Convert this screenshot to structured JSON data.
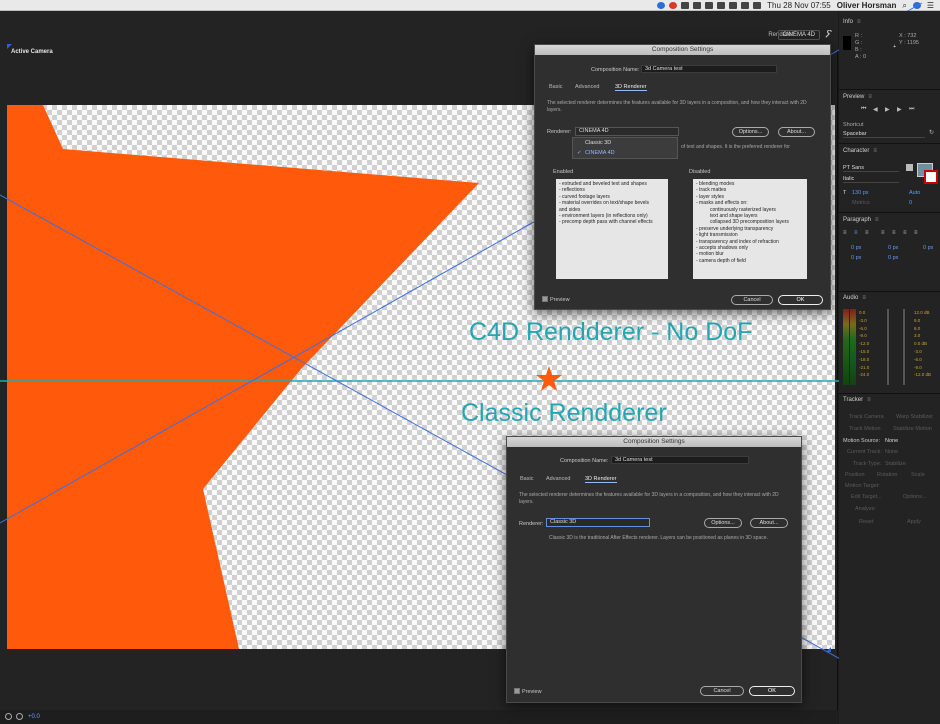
{
  "menubar": {
    "date_time": "Thu 28 Nov  07:55",
    "user": "Oliver Horsman"
  },
  "viewer": {
    "camera_label": "Active Camera",
    "renderer_label": "Renderer:",
    "renderer_value": "CINEMA 4D",
    "zoom": "+0.0"
  },
  "annotations": {
    "c4d": "C4D Rendderer - No DoF",
    "classic": "Classic Rendderer"
  },
  "dialog_c4d": {
    "title": "Composition Settings",
    "name_label": "Composition Name:",
    "name_value": "3d Camera test",
    "tabs": [
      "Basic",
      "Advanced",
      "3D Renderer"
    ],
    "description": "The selected renderer determines the features available for 3D layers in a composition, and how they interact with 2D layers.",
    "renderer_label": "Renderer:",
    "renderer_value": "CINEMA 4D",
    "dropdown_options": [
      "Classic 3D",
      "CINEMA 4D"
    ],
    "options_button": "Options...",
    "about_button": "About...",
    "note": "of text and shapes. It is the preferred renderer for",
    "enabled_title": "Enabled",
    "enabled_items": [
      "- extruded and beveled text and shapes",
      "- reflections",
      "- curved footage layers",
      "- material overrides on text/shape bevels",
      "and sides",
      "- environment layers (in reflections only)",
      "- precomp depth pass with channel effects"
    ],
    "disabled_title": "Disabled",
    "disabled_items": [
      "- blending modes",
      "- track mattes",
      "- layer styles",
      "- masks and effects on:",
      "continuously rasterized layers",
      "text and shape layers",
      "collapsed 3D precomposition layers",
      "- preserve underlying transparency",
      "- light transmission",
      "- transparency and index of refraction",
      "- accepts shadows only",
      "- motion blur",
      "- camera depth of field"
    ],
    "preview_label": "Preview",
    "cancel_button": "Cancel",
    "ok_button": "OK"
  },
  "dialog_classic": {
    "title": "Composition Settings",
    "name_label": "Composition Name:",
    "name_value": "3d Camera test",
    "tabs": [
      "Basic",
      "Advanced",
      "3D Renderer"
    ],
    "description": "The selected renderer determines the features available for 3D layers in a composition, and how they interact with 2D layers.",
    "renderer_label": "Renderer:",
    "renderer_value": "Classic 3D",
    "options_button": "Options...",
    "about_button": "About...",
    "note": "Classic 3D is the traditional After Effects renderer. Layers can be positioned as planes in 3D space.",
    "preview_label": "Preview",
    "cancel_button": "Cancel",
    "ok_button": "OK"
  },
  "panels": {
    "info": {
      "title": "Info",
      "r": "R :",
      "g": "G :",
      "b": "B :",
      "a": "A : 0",
      "x": "X : 732",
      "y": "Y : 1195"
    },
    "preview": {
      "title": "Preview",
      "shortcut_label": "Shortcut",
      "shortcut_value": "Spacebar"
    },
    "character": {
      "title": "Character",
      "font": "PT Sans",
      "style": "Italic",
      "size": "130 px",
      "leading": "Auto",
      "kerning": "Metrics",
      "tracking": "0"
    },
    "paragraph": {
      "title": "Paragraph",
      "values": [
        "0 px",
        "0 px",
        "0 px",
        "0 px",
        "0 px"
      ]
    },
    "audio": {
      "title": "Audio",
      "left_scale": [
        "0.0",
        "-3.0",
        "-6.0",
        "-9.0",
        "-12.0",
        "-15.0",
        "-18.0",
        "-21.0",
        "-24.0"
      ],
      "right_scale": [
        "12.0 dB",
        "9.0",
        "6.0",
        "3.0",
        "0.0 dB",
        "-3.0",
        "-6.0",
        "-9.0",
        "-12.0 dB"
      ]
    },
    "tracker": {
      "title": "Tracker",
      "track_camera": "Track Camera",
      "warp_stabilizer": "Warp Stabilizer",
      "track_motion": "Track Motion",
      "stabilize_motion": "Stabilize Motion",
      "motion_source_label": "Motion Source:",
      "motion_source_value": "None",
      "current_track_label": "Current Track:",
      "current_track_value": "None",
      "track_type_label": "Track Type:",
      "track_type_value": "Stabilize",
      "position": "Position",
      "rotation": "Rotation",
      "scale": "Scale",
      "motion_target": "Motion Target:",
      "edit_target": "Edit Target...",
      "options": "Options...",
      "analyze": "Analyze:",
      "reset": "Reset",
      "apply": "Apply"
    }
  }
}
